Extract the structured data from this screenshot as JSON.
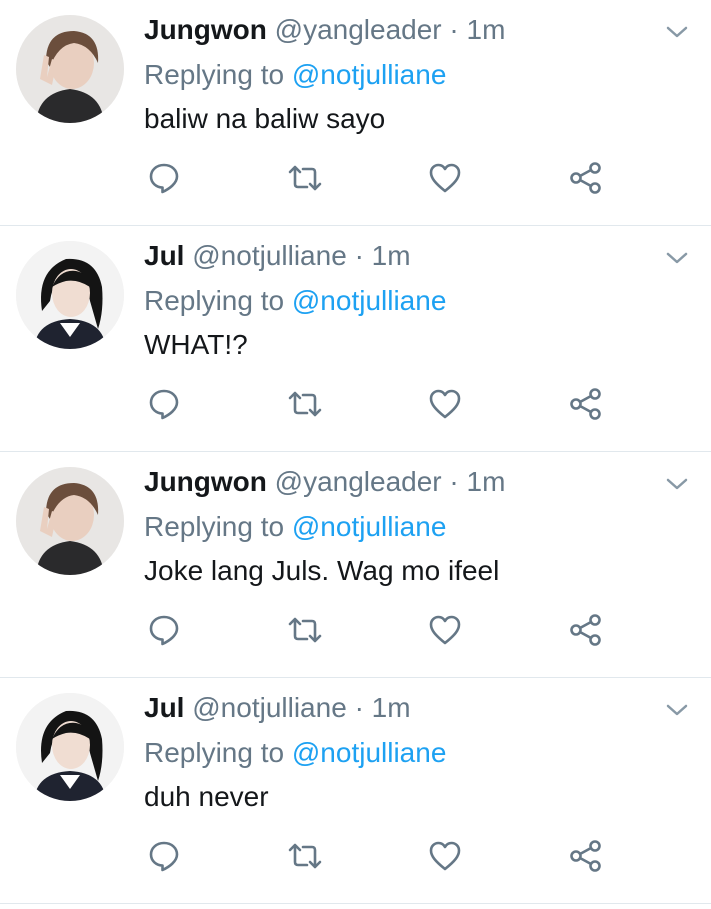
{
  "colors": {
    "name": "#14171a",
    "muted": "#657786",
    "link": "#1da1f2",
    "divider": "#e1e8ed",
    "icon": "#657786"
  },
  "tweets": [
    {
      "author": "Jungwon",
      "handle": "@yangleader",
      "separator": "·",
      "time": "1m",
      "replying_prefix": "Replying to",
      "replying_to": "@notjulliane",
      "text": "baliw na baliw sayo",
      "avatar": "jungwon-avatar"
    },
    {
      "author": "Jul",
      "handle": "@notjulliane",
      "separator": "·",
      "time": "1m",
      "replying_prefix": "Replying to",
      "replying_to": "@notjulliane",
      "text": "WHAT!?",
      "avatar": "jul-avatar"
    },
    {
      "author": "Jungwon",
      "handle": "@yangleader",
      "separator": "·",
      "time": "1m",
      "replying_prefix": "Replying to",
      "replying_to": "@notjulliane",
      "text": "Joke lang Juls. Wag mo ifeel",
      "avatar": "jungwon-avatar"
    },
    {
      "author": "Jul",
      "handle": "@notjulliane",
      "separator": "·",
      "time": "1m",
      "replying_prefix": "Replying to",
      "replying_to": "@notjulliane",
      "text": "duh never",
      "avatar": "jul-avatar"
    }
  ],
  "action_icons": [
    "reply-icon",
    "retweet-icon",
    "like-icon",
    "share-icon"
  ],
  "menu_icon": "chevron-down-icon"
}
